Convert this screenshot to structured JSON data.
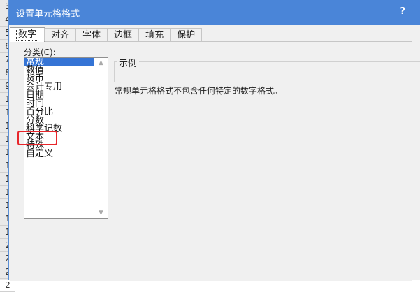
{
  "background": {
    "row_numbers": [
      "3",
      "4",
      "5",
      "6",
      "7",
      "8",
      "9",
      "1",
      "1",
      "1",
      "1",
      "1",
      "1",
      "1",
      "1",
      "1",
      "1",
      "1",
      "2",
      "2",
      "2",
      "2"
    ]
  },
  "dialog": {
    "title": "设置单元格格式",
    "help": "?",
    "tabs": [
      {
        "label": "数字",
        "active": true
      },
      {
        "label": "对齐",
        "active": false
      },
      {
        "label": "字体",
        "active": false
      },
      {
        "label": "边框",
        "active": false
      },
      {
        "label": "填充",
        "active": false
      },
      {
        "label": "保护",
        "active": false
      }
    ],
    "category_label": "分类(C):",
    "categories": [
      {
        "label": "常规",
        "selected": true
      },
      {
        "label": "数值",
        "selected": false
      },
      {
        "label": "货币",
        "selected": false
      },
      {
        "label": "会计专用",
        "selected": false
      },
      {
        "label": "日期",
        "selected": false
      },
      {
        "label": "时间",
        "selected": false
      },
      {
        "label": "百分比",
        "selected": false
      },
      {
        "label": "分数",
        "selected": false
      },
      {
        "label": "科学记数",
        "selected": false
      },
      {
        "label": "文本",
        "selected": false
      },
      {
        "label": "特殊",
        "selected": false
      },
      {
        "label": "自定义",
        "selected": false
      }
    ],
    "sample_label": "示例",
    "description": "常规单元格格式不包含任何特定的数字格式。"
  },
  "colors": {
    "titlebar": "#4a85d8",
    "selection": "#3574d5",
    "highlight": "#e8262b"
  }
}
